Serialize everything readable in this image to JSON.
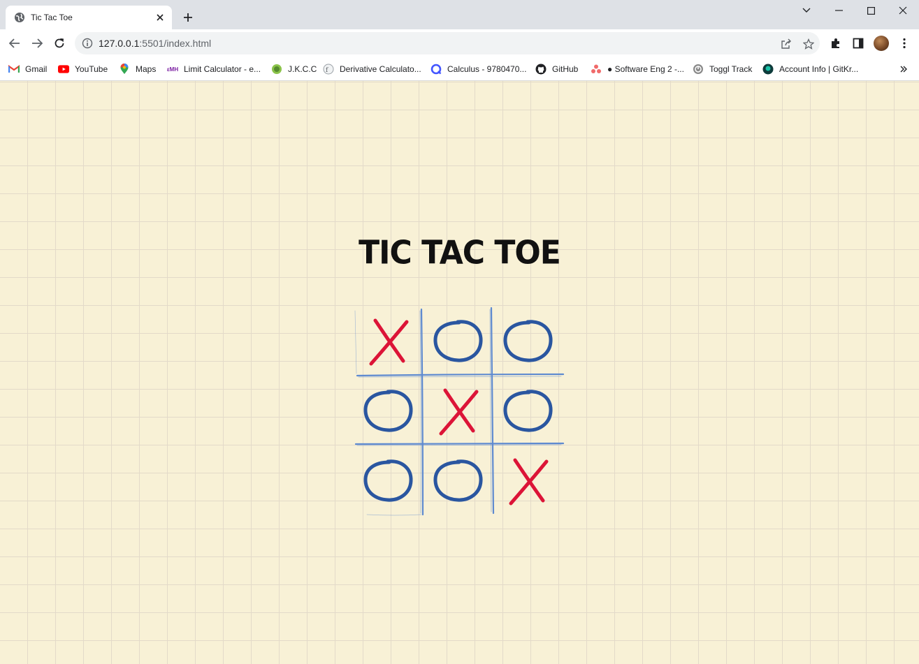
{
  "browser": {
    "tab_title": "Tic Tac Toe",
    "url_host": "127.0.0.1",
    "url_rest": ":5501/index.html",
    "bookmarks": [
      {
        "label": "Gmail",
        "icon": "gmail-icon"
      },
      {
        "label": "YouTube",
        "icon": "youtube-icon"
      },
      {
        "label": "Maps",
        "icon": "maps-icon"
      },
      {
        "label": "Limit Calculator - e...",
        "icon": "emathhelp-icon"
      },
      {
        "label": "J.K.C.C",
        "icon": "jkcc-icon"
      },
      {
        "label": "Derivative Calculato...",
        "icon": "derivative-icon"
      },
      {
        "label": "Calculus - 9780470...",
        "icon": "quizlet-icon"
      },
      {
        "label": "GitHub",
        "icon": "github-icon"
      },
      {
        "label": "● Software Eng 2 -...",
        "icon": "asana-icon"
      },
      {
        "label": "Toggl Track",
        "icon": "toggl-icon"
      },
      {
        "label": "Account Info | GitKr...",
        "icon": "gitkraken-icon"
      }
    ]
  },
  "game": {
    "title": "TIC TAC TOE",
    "board": [
      "X",
      "O",
      "O",
      "O",
      "X",
      "O",
      "O",
      "O",
      "X"
    ],
    "colors": {
      "x": "#dc1437",
      "o": "#2a56a0",
      "grid": "#5e8ad0",
      "page": "#f8f1d6",
      "paper_lines": "#e3dac9"
    }
  }
}
